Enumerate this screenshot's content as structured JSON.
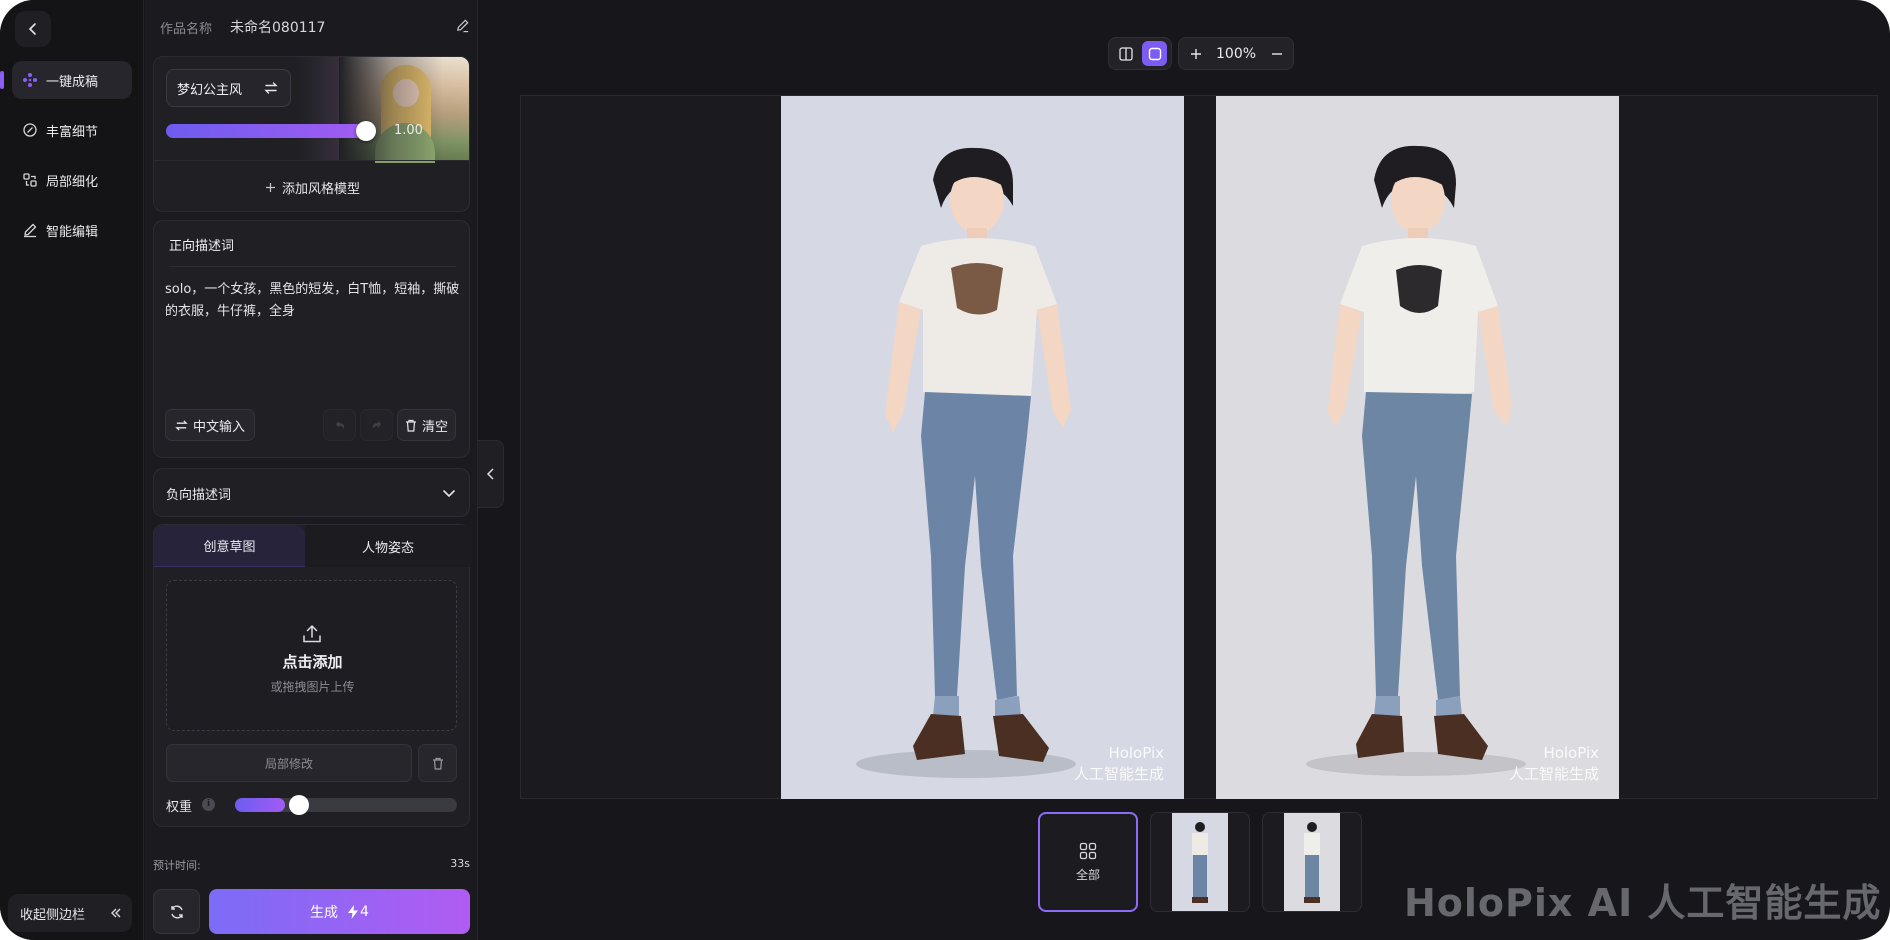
{
  "nav": {
    "items": [
      {
        "label": "一键成稿",
        "icon": "grid-dots-icon",
        "active": true
      },
      {
        "label": "丰富细节",
        "icon": "sparkle-edit-icon",
        "active": false
      },
      {
        "label": "局部细化",
        "icon": "crop-detail-icon",
        "active": false
      },
      {
        "label": "智能编辑",
        "icon": "pencil-icon",
        "active": false
      }
    ],
    "collapse_label": "收起侧边栏"
  },
  "project": {
    "name_label": "作品名称",
    "name_value": "未命名080117"
  },
  "style_model": {
    "name": "梦幻公主风",
    "strength": "1.00",
    "strength_fraction": 1.0,
    "add_label": "添加风格模型"
  },
  "prompt": {
    "header": "正向描述词",
    "text": "solo，一个女孩，黑色的短发，白T恤，短袖，撕破的衣服，牛仔裤，全身",
    "translate_label": "中文输入",
    "clear_label": "清空"
  },
  "negative_prompt": {
    "header": "负向描述词"
  },
  "reference": {
    "tabs": [
      "创意草图",
      "人物姿态"
    ],
    "active_tab": 0,
    "upload_title": "点击添加",
    "upload_sub": "或拖拽图片上传",
    "local_edit_label": "局部修改",
    "weight_label": "权重",
    "weight_fraction": 0.25
  },
  "generate": {
    "estimate_label": "预计时间:",
    "estimate_value": "33s",
    "button_label": "生成",
    "cost": "4"
  },
  "toolbar": {
    "zoom": "100%"
  },
  "canvas": {
    "watermark_line1": "HoloPix",
    "watermark_line2": "人工智能生成"
  },
  "thumbnails": {
    "all_label": "全部"
  },
  "brand_watermark": "HoloPix AI 人工智能生成",
  "colors": {
    "accent": "#8b5cf6",
    "gradient_start": "#7b6cf6",
    "gradient_end": "#b15cf2",
    "background": "#17171b"
  }
}
